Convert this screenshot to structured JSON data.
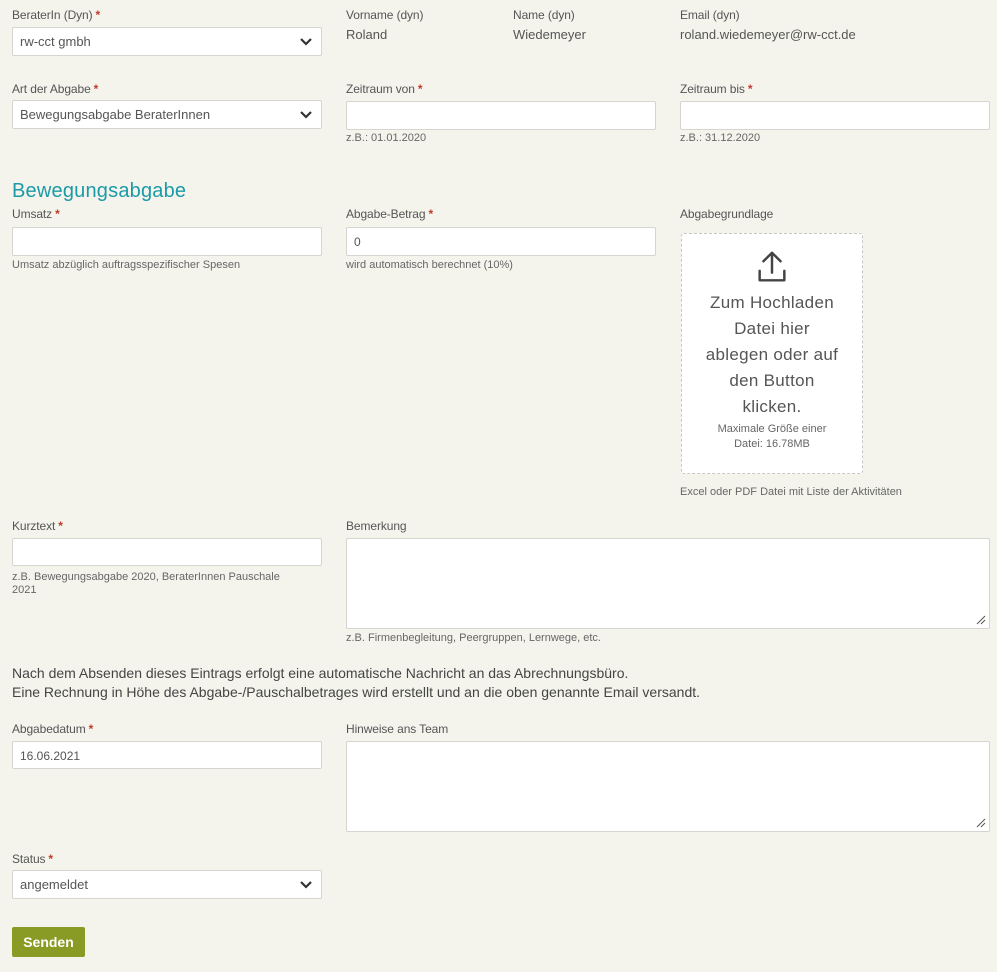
{
  "berater": {
    "label": "BeraterIn (Dyn)",
    "value": "rw-cct gmbh"
  },
  "vorname": {
    "label": "Vorname (dyn)",
    "value": "Roland"
  },
  "name": {
    "label": "Name (dyn)",
    "value": "Wiedemeyer"
  },
  "email": {
    "label": "Email (dyn)",
    "value": "roland.wiedemeyer@rw-cct.de"
  },
  "art": {
    "label": "Art der Abgabe",
    "value": "Bewegungsabgabe BeraterInnen"
  },
  "zeitraum_von": {
    "label": "Zeitraum von",
    "value": "",
    "hint": "z.B.: 01.01.2020"
  },
  "zeitraum_bis": {
    "label": "Zeitraum bis",
    "value": "",
    "hint": "z.B.: 31.12.2020"
  },
  "section_title": "Bewegungsabgabe",
  "umsatz": {
    "label": "Umsatz",
    "value": "",
    "hint": "Umsatz abzüglich auftragsspezifischer Spesen"
  },
  "abgabe_betrag": {
    "label": "Abgabe-Betrag",
    "value": "0",
    "hint": "wird automatisch berechnet (10%)"
  },
  "abgabegrundlage": {
    "label": "Abgabegrundlage",
    "drop_text": [
      "Zum Hochladen",
      "Datei hier",
      "ablegen oder auf",
      "den Button",
      "klicken."
    ],
    "size_text": [
      "Maximale Größe einer",
      "Datei: 16.78MB"
    ],
    "hint": "Excel oder PDF Datei mit Liste der Aktivitäten"
  },
  "kurztext": {
    "label": "Kurztext",
    "value": "",
    "hint_lines": [
      "z.B. Bewegungsabgabe 2020, BeraterInnen Pauschale",
      "2021"
    ]
  },
  "bemerkung": {
    "label": "Bemerkung",
    "value": "",
    "hint": "z.B. Firmenbegleitung, Peergruppen, Lernwege, etc."
  },
  "notice": [
    "Nach dem Absenden dieses Eintrags erfolgt eine automatische Nachricht an das Abrechnungsbüro.",
    "Eine Rechnung in Höhe des Abgabe-/Pauschalbetrages wird erstellt und an die oben genannte Email versandt."
  ],
  "abgabedatum": {
    "label": "Abgabedatum",
    "value": "16.06.2021"
  },
  "hinweise": {
    "label": "Hinweise ans Team",
    "value": ""
  },
  "status": {
    "label": "Status",
    "value": "angemeldet"
  },
  "required_marker": "*",
  "submit_label": "Senden",
  "colors": {
    "accent": "#1a9ba6",
    "button": "#8a9b25",
    "required": "#c0392b",
    "background": "#f4f4ed"
  }
}
